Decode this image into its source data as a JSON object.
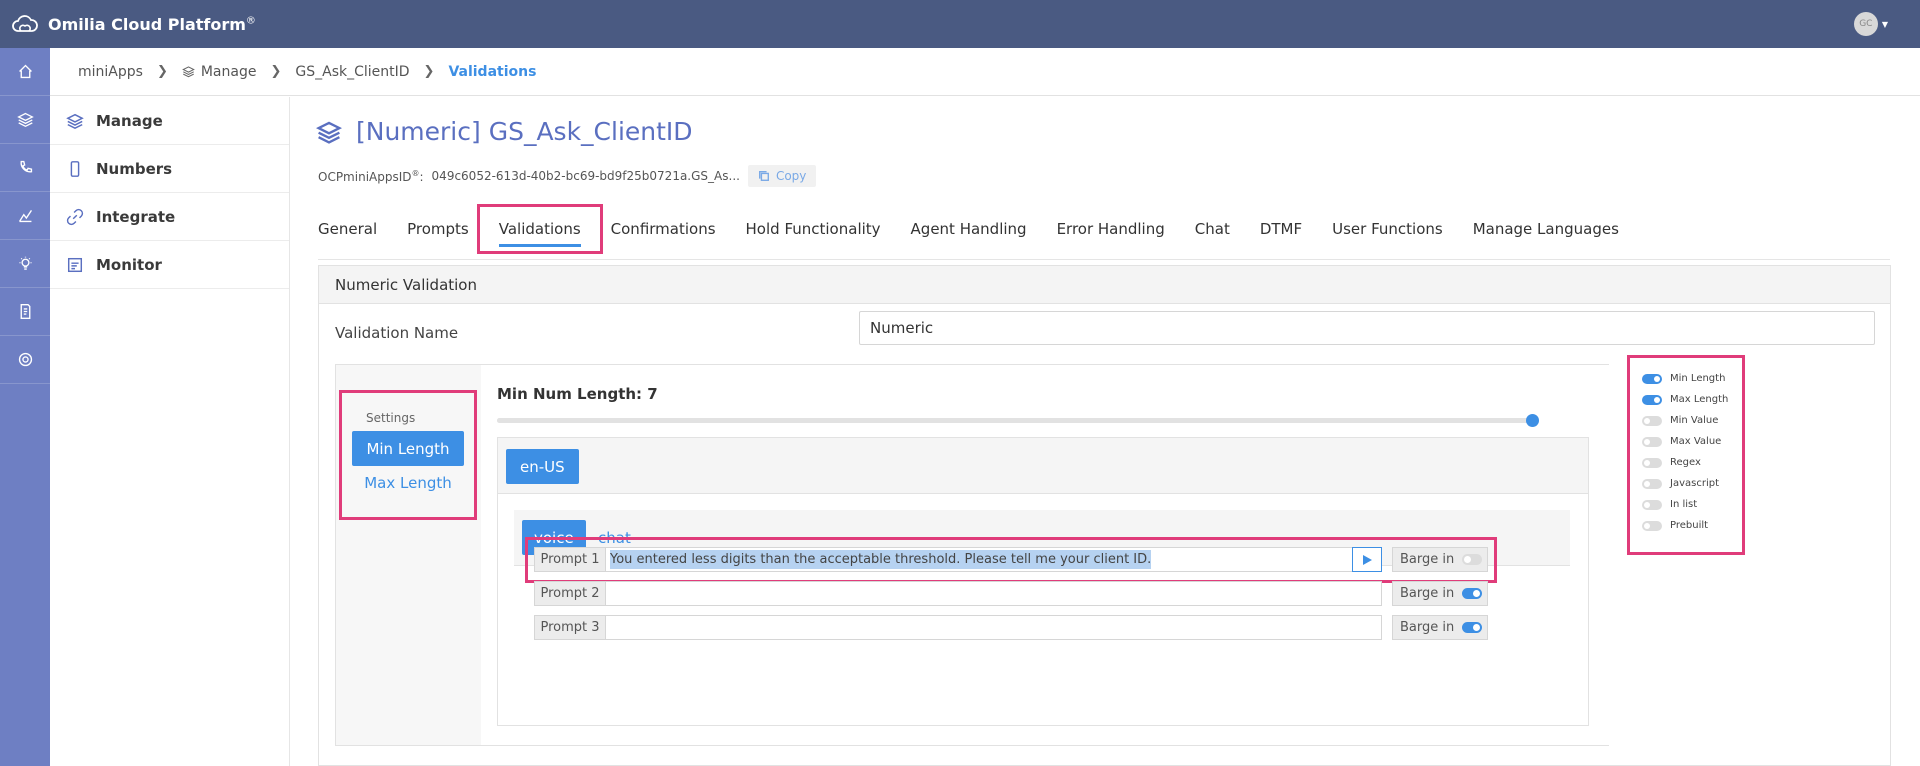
{
  "app": {
    "title": "Omilia Cloud Platform",
    "title_mark": "®",
    "avatar_initials": "GC"
  },
  "rail": {
    "items": [
      "home-icon",
      "layers-icon",
      "phone-icon",
      "analytics-icon",
      "bulb-icon",
      "billing-icon",
      "support-icon"
    ]
  },
  "breadcrumb": {
    "items": [
      "miniApps",
      "Manage",
      "GS_Ask_ClientID",
      "Validations"
    ]
  },
  "sidenav": {
    "items": [
      {
        "label": "Manage",
        "icon": "layers-icon"
      },
      {
        "label": "Numbers",
        "icon": "phone-icon"
      },
      {
        "label": "Integrate",
        "icon": "link-icon"
      },
      {
        "label": "Monitor",
        "icon": "monitor-icon"
      }
    ]
  },
  "page": {
    "title": "[Numeric] GS_Ask_ClientID",
    "id_label": "OCPminiAppsID",
    "id_mark": "®",
    "id_sep": ":",
    "id_value": "049c6052-613d-40b2-bc69-bd9f25b0721a.GS_As...",
    "copy_label": "Copy"
  },
  "tabs": [
    "General",
    "Prompts",
    "Validations",
    "Confirmations",
    "Hold Functionality",
    "Agent Handling",
    "Error Handling",
    "Chat",
    "DTMF",
    "User Functions",
    "Manage Languages"
  ],
  "panel": {
    "title": "Numeric Validation",
    "validation_name_label": "Validation Name",
    "validation_name_value": "Numeric",
    "settings_title": "Settings",
    "settings_buttons": [
      "Min Length",
      "Max Length"
    ],
    "slider_label": "Min Num Length: 7",
    "slider_value_fraction": 1.0,
    "language": "en-US",
    "modes": [
      "voice",
      "chat"
    ],
    "prompts": [
      {
        "label": "Prompt 1",
        "value": "You entered less digits than the acceptable threshold. Please tell me your client ID.",
        "barge_label": "Barge in",
        "barge_on": false
      },
      {
        "label": "Prompt 2",
        "value": "",
        "barge_label": "Barge in",
        "barge_on": true
      },
      {
        "label": "Prompt 3",
        "value": "",
        "barge_label": "Barge in",
        "barge_on": true
      }
    ]
  },
  "toggles": [
    {
      "label": "Min Length",
      "on": true
    },
    {
      "label": "Max Length",
      "on": true
    },
    {
      "label": "Min Value",
      "on": false
    },
    {
      "label": "Max Value",
      "on": false
    },
    {
      "label": "Regex",
      "on": false
    },
    {
      "label": "Javascript",
      "on": false
    },
    {
      "label": "In list",
      "on": false
    },
    {
      "label": "Prebuilt",
      "on": false
    }
  ],
  "colors": {
    "topbar": "#4a5a82",
    "rail": "#6e7fc3",
    "accent": "#3d8fe4",
    "highlight": "#e03c7a",
    "title": "#5a6fc0"
  }
}
